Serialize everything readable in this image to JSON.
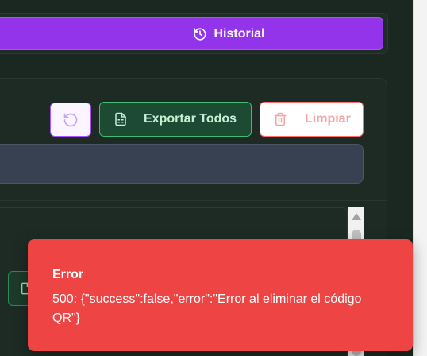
{
  "header": {
    "historial_label": "Historial"
  },
  "toolbar": {
    "export_label": "Exportar Todos",
    "clear_label": "Limpiar"
  },
  "toast": {
    "title": "Error",
    "message": "500: {\"success\":false,\"error\":\"Error al eliminar el código QR\"}"
  },
  "colors": {
    "purple": "#9333ea",
    "green": "#3bbf6e",
    "red": "#ef4444",
    "background": "#1b2721"
  },
  "icons": {
    "historial": "history-icon",
    "refresh": "refresh-icon",
    "export": "spreadsheet-icon",
    "clear": "trash-icon"
  }
}
